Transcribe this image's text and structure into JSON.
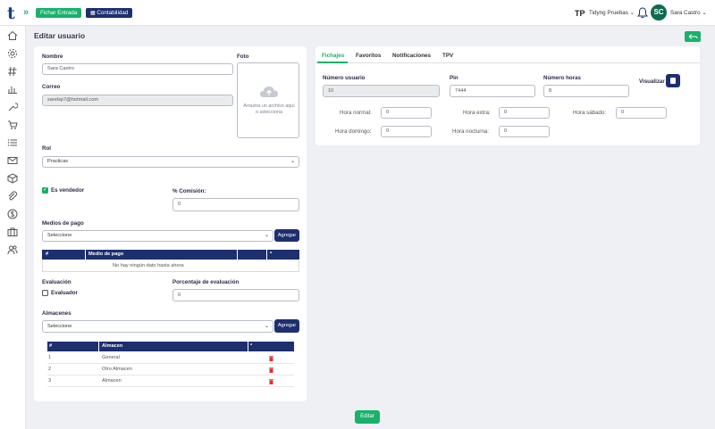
{
  "topbar": {
    "logo": "t",
    "chevrons": "»",
    "fichar_entrada": "Fichar Entrada",
    "contabilidad": "Contabilidad",
    "company_initials": "TP",
    "company_name": "Tidyng Pruebas ⌄",
    "user_initials": "SC",
    "user_name": "Sara Castro ⌄"
  },
  "sidebar": {
    "icons": [
      "home-icon",
      "settings-icon",
      "hash-icon",
      "chart-icon",
      "wrench-icon",
      "cart-icon",
      "list-icon",
      "mail-icon",
      "box-icon",
      "paperclip-icon",
      "dollar-icon",
      "briefcase-icon",
      "users-icon"
    ]
  },
  "page": {
    "title": "Editar usuario"
  },
  "form": {
    "nombre_label": "Nombre",
    "nombre_value": "Sara Castro",
    "correo_label": "Correo",
    "correo_value": "sarelsp7@hotmail.com",
    "foto_label": "Foto",
    "foto_hint": "Arrastra un archivo aquí o selecciona",
    "rol_label": "Rol",
    "rol_value": "Practicas",
    "vendedor_label": "Es vendedor",
    "vendedor_checked": true,
    "comision_label": "% Comisión:",
    "comision_value": "0",
    "medios_label": "Medios de pago",
    "medios_select": "Seleccione",
    "agregar": "Agregar",
    "medios_table": {
      "headers": [
        "#",
        "Medio de pago",
        "",
        "*"
      ],
      "empty": "No hay ningún dato hasta ahora"
    },
    "evaluacion_label": "Evaluación",
    "evaluador_label": "Evaluador",
    "evaluador_checked": false,
    "porcentaje_label": "Porcentaje de evaluación",
    "porcentaje_value": "0",
    "almacenes_label": "Almacenes",
    "almacenes_select": "Seleccione",
    "almacenes_table": {
      "headers": [
        "#",
        "Almacen",
        "*"
      ],
      "rows": [
        {
          "num": "1",
          "name": "General"
        },
        {
          "num": "2",
          "name": "Otro Almacen"
        },
        {
          "num": "3",
          "name": "Almacen"
        }
      ]
    }
  },
  "fichajes": {
    "tabs": [
      "Fichajes",
      "Favoritos",
      "Notificaciones",
      "TPV"
    ],
    "numero_usuario_label": "Número usuario",
    "numero_usuario_value": "10",
    "pin_label": "Pin",
    "pin_value": "7444",
    "numero_horas_label": "Número horas",
    "numero_horas_value": "8",
    "visualizar_label": "Visualizar",
    "hora_normal_label": "Hora normal:",
    "hora_normal_value": "0",
    "hora_extra_label": "Hora extra:",
    "hora_extra_value": "0",
    "hora_sabado_label": "Hora sábado:",
    "hora_sabado_value": "0",
    "hora_domingo_label": "Hora domingo:",
    "hora_domingo_value": "0",
    "hora_nocturna_label": "Hora nocturna:",
    "hora_nocturna_value": "0"
  },
  "footer": {
    "editar": "Editar"
  },
  "colors": {
    "green": "#1ab16a",
    "navy": "#1d2f6f",
    "background": "#eef0f4",
    "delete": "#e03131"
  }
}
